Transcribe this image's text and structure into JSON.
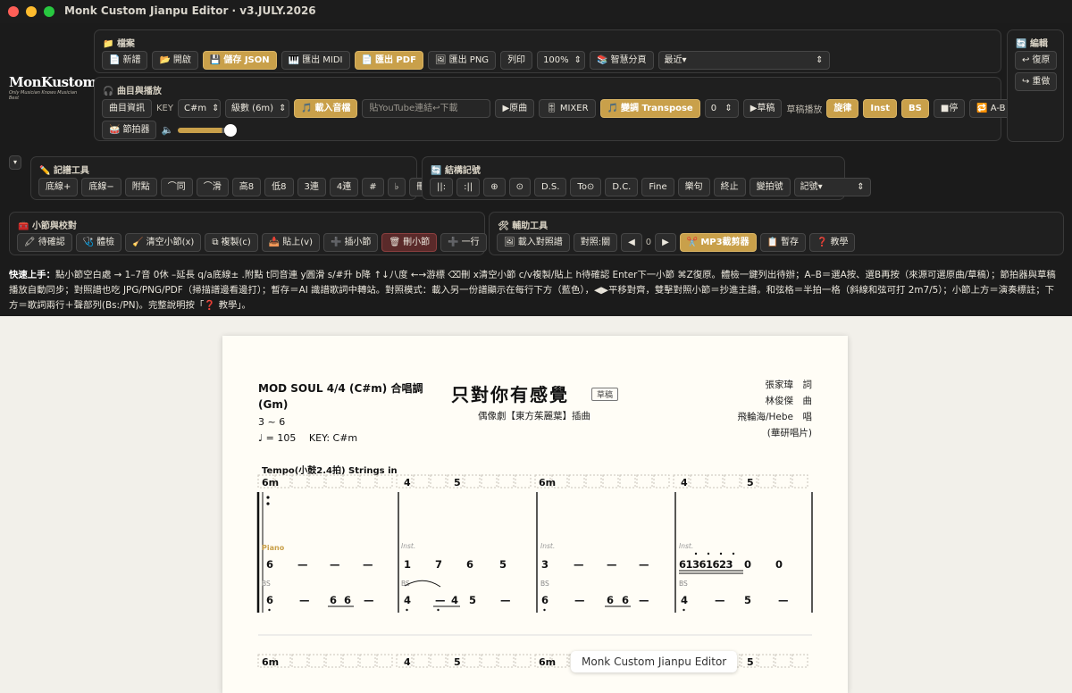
{
  "window": {
    "title": "Monk Custom Jianpu Editor · v3.JULY.2026"
  },
  "logo": {
    "name": "MonKustom",
    "tagline": "Only Musician Knows Musician Best"
  },
  "file": {
    "title": "檔案",
    "new": "新譜",
    "open": "開啟",
    "save_json": "儲存 JSON",
    "export_midi": "匯出 MIDI",
    "export_pdf": "匯出 PDF",
    "export_png": "匯出 PNG",
    "print": "列印",
    "zoom": "100%",
    "smart_page": "智慧分頁",
    "recent": "最近▾"
  },
  "edit": {
    "title": "編輯",
    "undo": "復原",
    "redo": "重做"
  },
  "playback": {
    "title": "曲目與播放",
    "song_info": "曲目資訊",
    "key_label": "KEY",
    "key": "C#m",
    "level": "級數 (6m)",
    "load_audio": "載入音檔",
    "youtube_placeholder": "貼YouTube連結↩下載",
    "original": "▶原曲",
    "mixer": "MIXER",
    "transpose": "變調 Transpose",
    "transpose_value": "0",
    "draft": "▶草稿",
    "draft_label": "草稿播放",
    "melody": "旋律",
    "inst": "Inst",
    "bs": "BS",
    "stop": "■停",
    "ab": "A-B",
    "metronome": "節拍器",
    "volume": 0.8
  },
  "notation": {
    "title": "記譜工具",
    "items": [
      "底線+",
      "底線−",
      "附點",
      "⌒同",
      "⌒滑",
      "高8",
      "低8",
      "3連",
      "4連",
      "#",
      "♭",
      "刪音"
    ]
  },
  "structure": {
    "title": "結構記號",
    "items": [
      "||:",
      ":||",
      "⊕",
      "⊙",
      "D.S.",
      "To⊙",
      "D.C.",
      "Fine",
      "樂句",
      "終止",
      "變拍號"
    ],
    "marks": "記號▾"
  },
  "measure": {
    "title": "小節與校對",
    "confirm": "待確認",
    "check": "體檢",
    "clear": "清空小節(x)",
    "copy": "複製(c)",
    "paste": "貼上(v)",
    "insert": "插小節",
    "delete": "刪小節",
    "add_row": "一行"
  },
  "tools": {
    "title": "輔助工具",
    "load_ref": "載入對照譜",
    "compare": "對照:關",
    "offset": "0",
    "mp3_cutter": "MP3截剪器",
    "stash": "暫存",
    "tutorial": "教學"
  },
  "help": {
    "lead": "快速上手：",
    "line1": "點小節空白處 → 1–7音 0休 –延長 q/a底線± .附點 t同音連 y圓滑 s/#升 b降 ↑↓八度 ←→游標 ⌫刪 x清空小節 c/v複製/貼上 h待確認 Enter下一小節 ⌘Z復原。體檢一鍵列出待辦；A–B＝選A按、選B再按（來源可選原曲/草稿）；節拍器與草稿播放自動同步；對照譜也吃 JPG/PNG/PDF（掃描譜邊看邊打）；暫存＝AI 識譜歌詞中轉站。對照模式：載入另一份譜顯示在每行下方（藍色），◀▶平移對齊，雙擊對照小節＝抄進主譜。和弦格＝半拍一格（斜線和弦可打 2m7/5）；小節上方＝演奏標註；下方＝歌詞兩行＋聲部列(Bs:/PN)。完整說明按「❓ 教學」。"
  },
  "score": {
    "style": "MOD SOUL 4/4 (C#m) 合唱調",
    "style2": "(Gm)",
    "range": "3 ~ 6",
    "tempo": "♩ = 105",
    "key": "KEY: C#m",
    "title": "只對你有感覺",
    "draft_badge": "草稿",
    "subtitle": "偶像劇【東方茱麗葉】插曲",
    "lyricist": "張家瑋　詞",
    "composer": "林俊傑　曲",
    "singer": "飛輪海/Hebe　唱",
    "label": "(華研唱片)",
    "tempo_note": "Tempo(小鼓2.4拍) Strings in",
    "chords": [
      "6m",
      "4",
      "5",
      "6m",
      "4",
      "5"
    ],
    "lower_chords": [
      "6m",
      "4",
      "5",
      "6m",
      "5"
    ],
    "part_piano": "Piano",
    "part_inst": "Inst.",
    "part_bs": "BS",
    "melody": [
      [
        "6",
        "—",
        "—",
        "—"
      ],
      [
        "1",
        "7",
        "6",
        "5"
      ],
      [
        "3",
        "—",
        "—",
        "—"
      ],
      [
        "61361623",
        "0",
        "0"
      ]
    ],
    "bass": [
      [
        "6",
        "—",
        "6",
        "6",
        "—"
      ],
      [
        "4",
        "—",
        "4",
        "5",
        "—",
        "—"
      ],
      [
        "6",
        "—",
        "6",
        "6",
        "—"
      ],
      [
        "4",
        "—",
        "5",
        "—"
      ]
    ]
  },
  "tooltip": "Monk Custom Jianpu Editor"
}
